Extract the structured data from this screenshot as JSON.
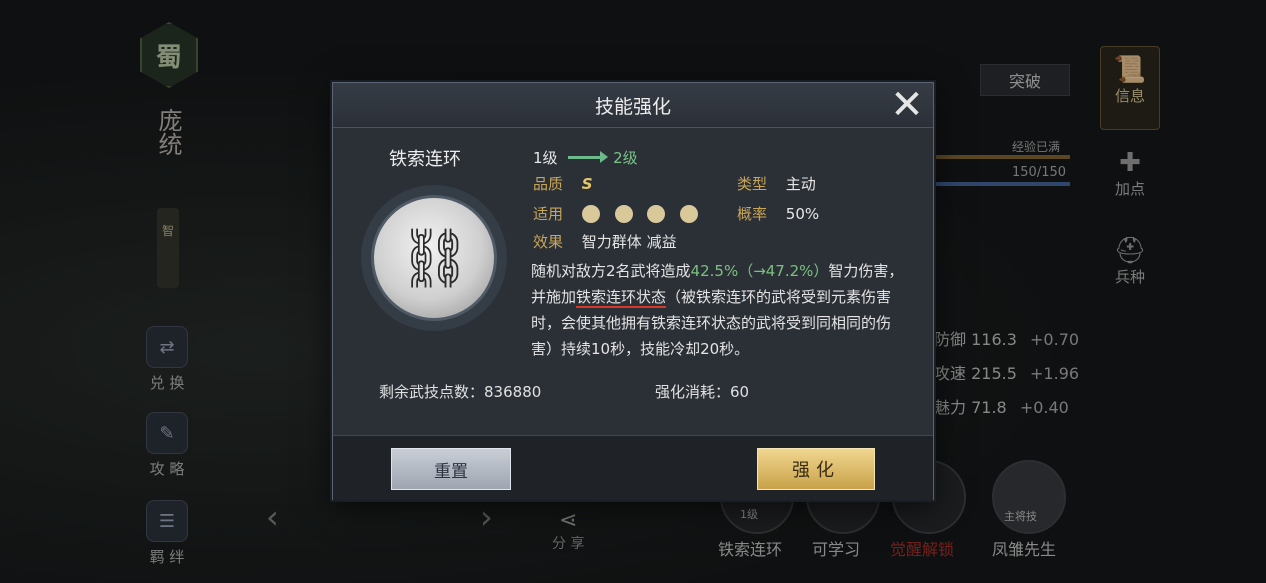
{
  "hero": {
    "faction": "蜀",
    "name": "庞统",
    "badge": "智"
  },
  "left_menu": [
    {
      "label": "兑 换"
    },
    {
      "label": "攻 略"
    },
    {
      "label": "羁 绊"
    }
  ],
  "share_label": "分 享",
  "right_tabs": [
    {
      "label": "信息",
      "icon": "scroll-icon"
    },
    {
      "label": "加点",
      "icon": "plus-icon"
    },
    {
      "label": "兵种",
      "icon": "helmet-icon"
    }
  ],
  "breakthrough_label": "突破",
  "exp": {
    "label": "经验已满",
    "value": "150/150"
  },
  "stats": [
    {
      "name": "防御",
      "value": "116.3",
      "plus": "+0.70"
    },
    {
      "name": "攻速",
      "value": "215.5",
      "plus": "+1.96"
    },
    {
      "name": "魅力",
      "value": "71.8",
      "plus": "+0.40"
    }
  ],
  "bottom_skills": [
    {
      "label": "铁索连环",
      "level": "1级"
    },
    {
      "label": "可学习"
    },
    {
      "label": "觉醒解锁"
    },
    {
      "label": "凤雏先生",
      "sub": "主将技"
    }
  ],
  "modal": {
    "title": "技能强化",
    "skill_name": "铁索连环",
    "level_from": "1级",
    "level_to": "2级",
    "quality_label": "品质",
    "quality_value": "S",
    "type_label": "类型",
    "type_value": "主动",
    "applicable_label": "适用",
    "rate_label": "概率",
    "rate_value": "50%",
    "effect_label": "效果",
    "effect_value": "智力群体  减益",
    "desc_part1": "随机对敌方2名武将造成",
    "desc_highlight": "42.5%（→47.2%）",
    "desc_part2": "智力伤害，并施加",
    "desc_underline": "铁索连环状态",
    "desc_part3": "（被铁索连环的武将受到元素伤害时，会使其他拥有铁索连环状态的武将受到同相同的伤害）持续10秒，技能冷却20秒。",
    "remain_label": "剩余武技点数：",
    "remain_value": "836880",
    "cost_label": "强化消耗：",
    "cost_value": "60",
    "reset_label": "重置",
    "enhance_label": "强化"
  },
  "colors": {
    "accent_gold": "#c9a558",
    "highlight_green": "#7cc07f",
    "underline_red": "#d63a2a"
  }
}
